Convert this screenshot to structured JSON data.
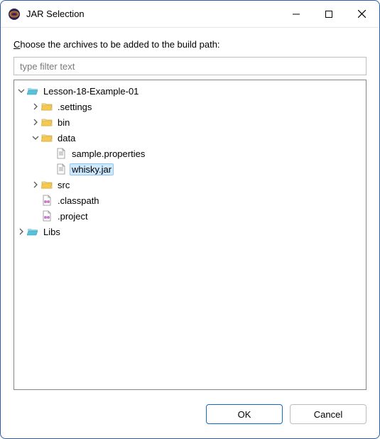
{
  "window": {
    "title": "JAR Selection"
  },
  "instruction": {
    "prefix_char": "C",
    "rest": "hoose the archives to be added to the build path:"
  },
  "filter": {
    "placeholder": "type filter text",
    "value": ""
  },
  "tree": {
    "root": {
      "label": "Lesson-18-Example-01",
      "settings_label": ".settings",
      "bin_label": "bin",
      "data": {
        "label": "data",
        "sample_label": "sample.properties",
        "whisky_label": "whisky.jar"
      },
      "src_label": "src",
      "classpath_label": ".classpath",
      "project_label": ".project"
    },
    "libs_label": "Libs"
  },
  "buttons": {
    "ok": "OK",
    "cancel": "Cancel"
  }
}
